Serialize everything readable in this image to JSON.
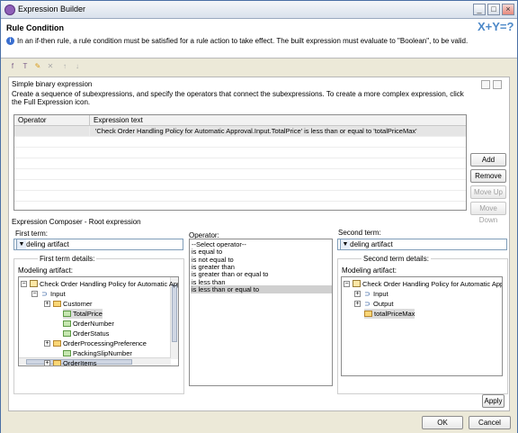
{
  "window": {
    "title": "Expression Builder"
  },
  "header": {
    "title": "Rule Condition",
    "info": "In an if-then rule, a rule condition must be satisfied for a rule action to take effect. The built expression must evaluate to \"Boolean\", to be valid.",
    "icon_text": "X+Y=?"
  },
  "binary": {
    "title": "Simple binary expression",
    "description": "Create a sequence of subexpressions, and specify the operators that connect the subexpressions. To create a more complex expression, click the Full Expression icon.",
    "columns": [
      "Operator",
      "Expression text"
    ],
    "rows": [
      {
        "operator": "",
        "expression": "'Check Order Handling Policy for Automatic Approval.Input.TotalPrice' is less than or equal to 'totalPriceMax'"
      }
    ],
    "buttons": {
      "add": "Add",
      "remove": "Remove",
      "move_up": "Move Up",
      "move_down": "Move Down"
    }
  },
  "composer": {
    "title": "Expression Composer - Root expression",
    "first_term_label": "First term:",
    "first_term_value": "Modeling artifact",
    "first_details": "First term details:",
    "first_artifact_label": "Modeling artifact:",
    "first_tree": [
      {
        "label": "Check Order Handling Policy for Automatic Appro",
        "icon": "doc",
        "expander": "−"
      },
      {
        "label": "Input",
        "icon": "input",
        "expander": "−"
      },
      {
        "label": "Customer",
        "icon": "folder",
        "expander": "+"
      },
      {
        "label": "TotalPrice",
        "icon": "field",
        "expander": ""
      },
      {
        "label": "OrderNumber",
        "icon": "field",
        "expander": ""
      },
      {
        "label": "OrderStatus",
        "icon": "field",
        "expander": ""
      },
      {
        "label": "OrderProcessingPreference",
        "icon": "folder",
        "expander": "+"
      },
      {
        "label": "PackingSlipNumber",
        "icon": "field",
        "expander": ""
      },
      {
        "label": "OrderItems",
        "icon": "folder",
        "expander": "+"
      }
    ],
    "operator_label": "Operator:",
    "operators": [
      "--Select operator--",
      "is equal to",
      "is not equal to",
      "is greater than",
      "is greater than or equal to",
      "is less than",
      "is less than or equal to"
    ],
    "selected_operator": "is less than or equal to",
    "second_term_label": "Second term:",
    "second_term_value": "Modeling artifact",
    "second_details": "Second term details:",
    "second_artifact_label": "Modeling artifact:",
    "second_tree": [
      {
        "label": "Check Order Handling Policy for Automatic Approv",
        "icon": "doc",
        "expander": "−"
      },
      {
        "label": "Input",
        "icon": "input",
        "expander": "+"
      },
      {
        "label": "Output",
        "icon": "input",
        "expander": "+"
      },
      {
        "label": "totalPriceMax",
        "icon": "folder",
        "expander": ""
      }
    ],
    "apply": "Apply"
  },
  "footer": {
    "ok": "OK",
    "cancel": "Cancel"
  }
}
